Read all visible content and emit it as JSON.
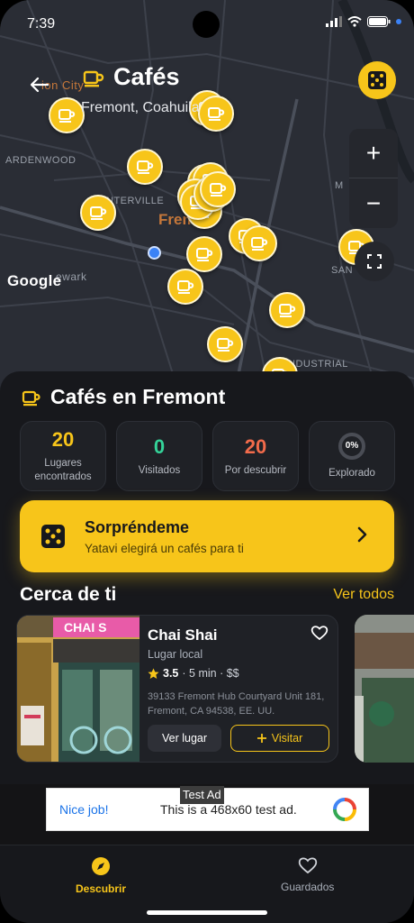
{
  "status_bar": {
    "time": "7:39"
  },
  "map": {
    "labels": [
      "ARDENWOOD",
      "NTERVILLE",
      "ewark",
      "NDUSTRIAL",
      "M",
      "SAN"
    ],
    "city_label": "Fremo",
    "city_label_top": "ion City",
    "attribution": "Google",
    "marker_count": 20
  },
  "header": {
    "title": "Cafés",
    "subtitle": "Fremont, Coahuila"
  },
  "zoom": {
    "in": "+",
    "out": "−"
  },
  "sheet": {
    "title": "Cafés en Fremont",
    "stats": [
      {
        "value": "20",
        "label": "Lugares encontrados",
        "color": "#f7c51a"
      },
      {
        "value": "0",
        "label": "Visitados",
        "color": "#34d399"
      },
      {
        "value": "20",
        "label": "Por descubrir",
        "color": "#f26b4b"
      },
      {
        "value": "0%",
        "label": "Explorado",
        "color": "#ffffff"
      }
    ],
    "surprise": {
      "title": "Sorpréndeme",
      "subtitle": "Yatavi elegirá un cafés para ti"
    },
    "nearby": {
      "title": "Cerca de ti",
      "see_all": "Ver todos",
      "card": {
        "name": "Chai Shai",
        "type": "Lugar local",
        "rating": "3.5",
        "distance": "· 5 min · $$",
        "address": "39133 Fremont Hub Courtyard Unit 181, Fremont, CA 94538, EE. UU.",
        "view_label": "Ver lugar",
        "visit_label": "Visitar",
        "sign_text": "CHAI S"
      }
    }
  },
  "ad": {
    "label": "Test Ad",
    "left_text": "Nice job!",
    "main_text": "This is a 468x60 test ad."
  },
  "nav": {
    "items": [
      {
        "label": "Descubrir",
        "active": true
      },
      {
        "label": "Guardados",
        "active": false
      }
    ]
  },
  "colors": {
    "accent": "#f7c51a",
    "background": "#17181c",
    "card": "#1f2126"
  }
}
